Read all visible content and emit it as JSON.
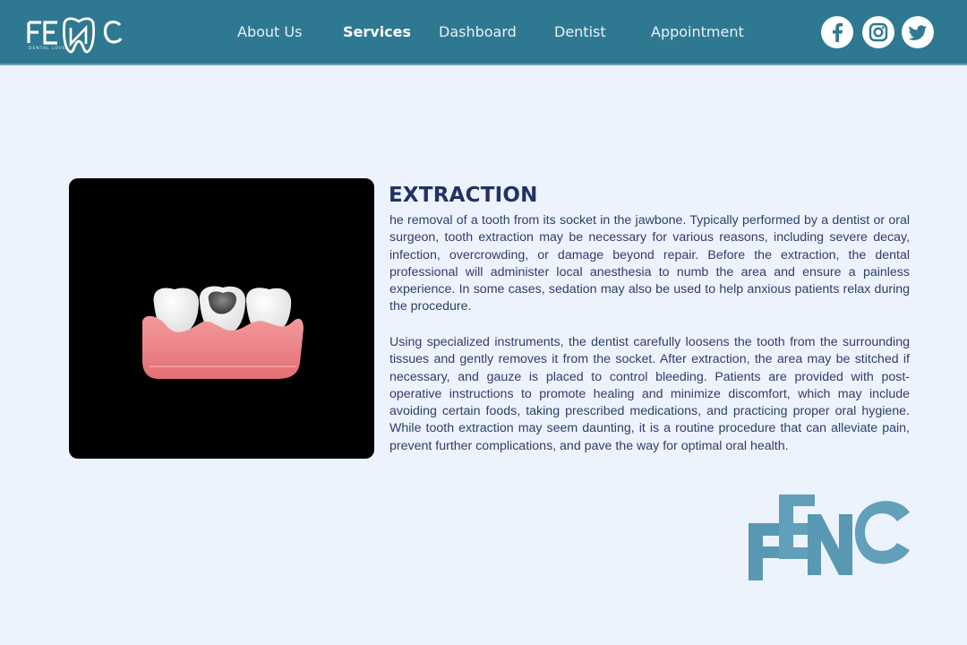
{
  "brand": {
    "logo_text": "FENC",
    "tagline": "DENTAL LOVE",
    "color_primary": "#2f7891",
    "color_watermark": "#3b88a8"
  },
  "nav": {
    "items": [
      {
        "label": "About Us",
        "active": false
      },
      {
        "label": "Services",
        "active": true
      },
      {
        "label": "Dashboard",
        "active": false
      },
      {
        "label": "Dentist",
        "active": false
      },
      {
        "label": "Appointment",
        "active": false
      }
    ]
  },
  "social": [
    {
      "name": "facebook-icon"
    },
    {
      "name": "instagram-icon"
    },
    {
      "name": "twitter-icon"
    }
  ],
  "content": {
    "title": "EXTRACTION",
    "paragraphs": [
      "he removal of a tooth from its socket in the jawbone. Typically performed by a dentist or oral surgeon, tooth extraction may be necessary for various reasons, including severe decay, infection, overcrowding, or damage beyond repair. Before the extraction, the dental professional will administer local anesthesia to numb the area and ensure a painless experience. In some cases, sedation may also be used to help anxious patients relax during the procedure.",
      "Using specialized instruments, the dentist carefully loosens the tooth from the surrounding tissues and gently removes it from the socket. After extraction, the area may be stitched if necessary, and gauze is placed to control bleeding. Patients are provided with post-operative instructions to promote healing and minimize discomfort, which may include avoiding certain foods, taking prescribed medications, and practicing proper oral hygiene. While tooth extraction may seem daunting, it is a routine procedure that can alleviate pain, prevent further complications, and pave the way for optimal oral health."
    ]
  },
  "media": {
    "subject": "teeth-model-illustration",
    "background": "#000000"
  }
}
